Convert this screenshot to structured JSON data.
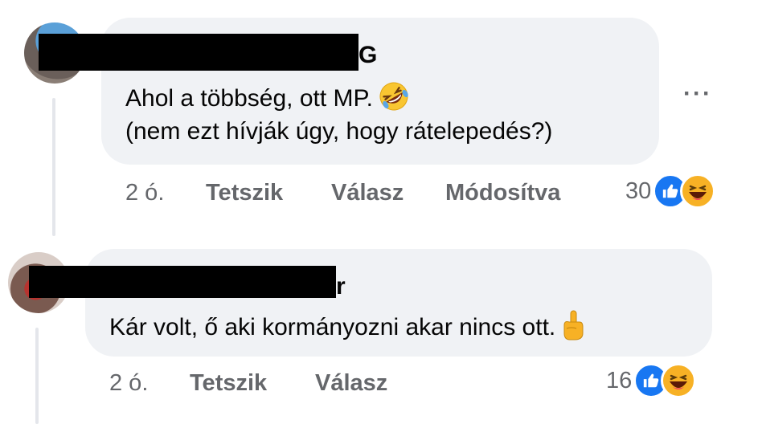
{
  "comments": [
    {
      "author_visible_tail": "G",
      "lines": [
        "Ahol a többség, ott MP.",
        "(nem ezt hívják úgy, hogy rátelepedés?)"
      ],
      "emoji_icon": "rolling-on-floor-laughing-emoji",
      "time": "2 ó.",
      "like_label": "Tetszik",
      "reply_label": "Válasz",
      "edited_label": "Módosítva",
      "reaction_count": "30",
      "reaction_icons": [
        "like-icon",
        "haha-icon"
      ],
      "more_label": "···"
    },
    {
      "author_visible_tail": "r",
      "lines": [
        "Kár volt, ő aki kormányozni akar nincs ott."
      ],
      "emoji_icon": "index-pointing-up-emoji",
      "time": "2 ó.",
      "like_label": "Tetszik",
      "reply_label": "Válasz",
      "reaction_count": "16",
      "reaction_icons": [
        "like-icon",
        "haha-icon"
      ]
    }
  ],
  "colors": {
    "bubble": "#f0f2f5",
    "text": "#050505",
    "secondary": "#65676b",
    "like_blue": "#1877f2",
    "haha_yellow": "#f7b125"
  }
}
